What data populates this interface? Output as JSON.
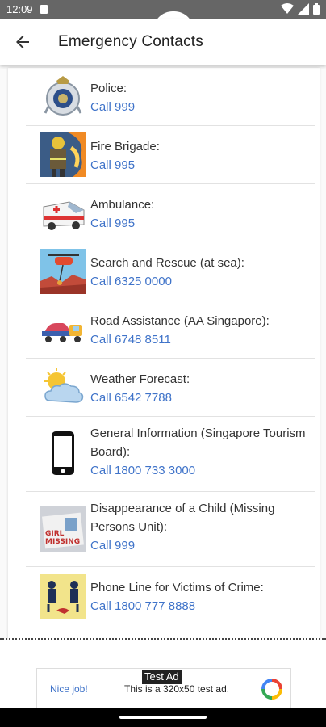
{
  "status": {
    "time": "12:09"
  },
  "appbar": {
    "title": "Emergency Contacts"
  },
  "contacts": [
    {
      "label": "Police:",
      "call": "Call 999",
      "icon": "police-badge-icon"
    },
    {
      "label": "Fire Brigade:",
      "call": "Call 995",
      "icon": "firefighter-icon"
    },
    {
      "label": "Ambulance:",
      "call": "Call 995",
      "icon": "ambulance-icon"
    },
    {
      "label": "Search and Rescue (at sea):",
      "call": "Call 6325 0000",
      "icon": "helicopter-rescue-icon"
    },
    {
      "label": "Road Assistance (AA Singapore):",
      "call": "Call 6748 8511",
      "icon": "tow-truck-icon"
    },
    {
      "label": "Weather Forecast:",
      "call": "Call 6542 7788",
      "icon": "weather-sun-cloud-icon"
    },
    {
      "label": "General Information (Singapore Tourism Board):",
      "call": "Call 1800 733 3000",
      "icon": "smartphone-icon"
    },
    {
      "label": "Disappearance of a Child (Missing Persons Unit):",
      "call": "Call 999",
      "icon": "missing-child-icon"
    },
    {
      "label": "Phone Line for Victims of Crime:",
      "call": "Call 1800 777 8888",
      "icon": "crime-scene-icon"
    }
  ],
  "ad": {
    "badge": "Test Ad",
    "nice": "Nice job!",
    "message": "This is a 320x50 test ad."
  },
  "colors": {
    "link": "#3f73c9",
    "statusbar": "#666666"
  }
}
